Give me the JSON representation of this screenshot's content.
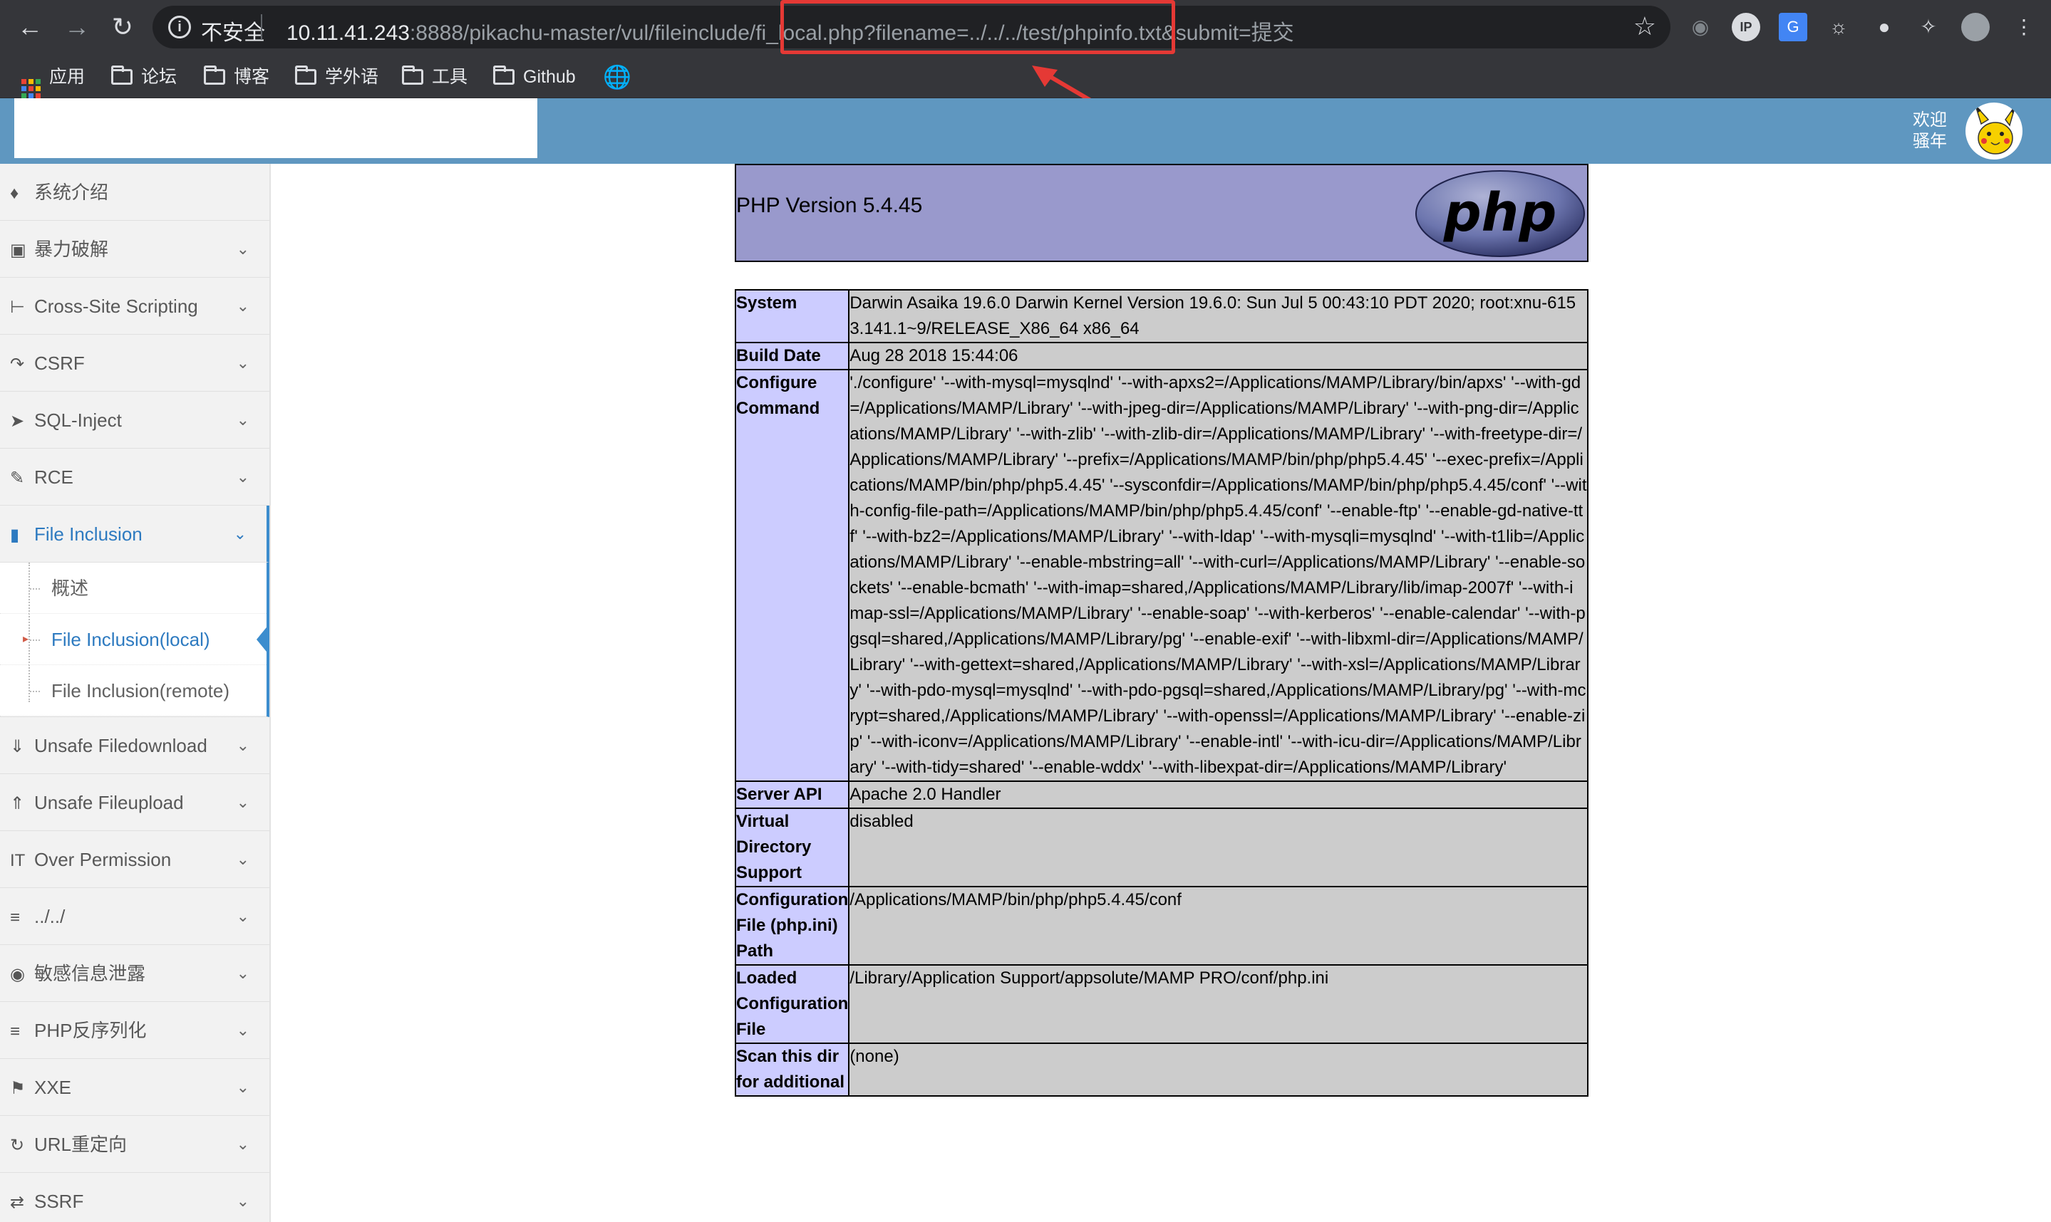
{
  "browser": {
    "insecure_label": "不安全",
    "url_host": "10.11.41.243",
    "url_rest": ":8888/pikachu-master/vul/fileinclude/fi_local.php?filename=../../../test/phpinfo.txt&submit=提交",
    "bookmarks": [
      "应用",
      "论坛",
      "博客",
      "学外语",
      "工具",
      "Github"
    ]
  },
  "header": {
    "welcome": "欢迎\n骚年"
  },
  "sidebar": {
    "items": [
      {
        "icon": "tag-icon",
        "label": "系统介绍",
        "chevron": false
      },
      {
        "icon": "lock-icon",
        "label": "暴力破解",
        "chevron": true
      },
      {
        "icon": "indent-icon",
        "label": "Cross-Site Scripting",
        "chevron": true
      },
      {
        "icon": "share-icon",
        "label": "CSRF",
        "chevron": true
      },
      {
        "icon": "fighter-jet-icon",
        "label": "SQL-Inject",
        "chevron": true
      },
      {
        "icon": "pencil-icon",
        "label": "RCE",
        "chevron": true
      },
      {
        "icon": "file-icon",
        "label": "File Inclusion",
        "chevron": true
      },
      {
        "icon": "download-icon",
        "label": "Unsafe Filedownload",
        "chevron": true
      },
      {
        "icon": "upload-icon",
        "label": "Unsafe Fileupload",
        "chevron": true
      },
      {
        "icon": "text-height-icon",
        "label": "Over Permission",
        "chevron": true
      },
      {
        "icon": "align-left-icon",
        "label": "../../",
        "chevron": true
      },
      {
        "icon": "camera-icon",
        "label": "敏感信息泄露",
        "chevron": true
      },
      {
        "icon": "list-icon",
        "label": "PHP反序列化",
        "chevron": true
      },
      {
        "icon": "flag-icon",
        "label": "XXE",
        "chevron": true
      },
      {
        "icon": "refresh-icon",
        "label": "URL重定向",
        "chevron": true
      },
      {
        "icon": "exchange-icon",
        "label": "SSRF",
        "chevron": true
      }
    ],
    "submenu": [
      "概述",
      "File Inclusion(local)",
      "File Inclusion(remote)"
    ]
  },
  "phpinfo": {
    "version": "PHP Version 5.4.45",
    "logo_text": "php",
    "rows": [
      {
        "key": "System",
        "value": "Darwin Asaika 19.6.0 Darwin Kernel Version 19.6.0: Sun Jul 5 00:43:10 PDT 2020; root:xnu-6153.141.1~9/RELEASE_X86_64 x86_64"
      },
      {
        "key": "Build Date",
        "value": "Aug 28 2018 15:44:06"
      },
      {
        "key": "Configure Command",
        "value": "'./configure' '--with-mysql=mysqlnd' '--with-apxs2=/Applications/MAMP/Library/bin/apxs' '--with-gd=/Applications/MAMP/Library' '--with-jpeg-dir=/Applications/MAMP/Library' '--with-png-dir=/Applications/MAMP/Library' '--with-zlib' '--with-zlib-dir=/Applications/MAMP/Library' '--with-freetype-dir=/Applications/MAMP/Library' '--prefix=/Applications/MAMP/bin/php/php5.4.45' '--exec-prefix=/Applications/MAMP/bin/php/php5.4.45' '--sysconfdir=/Applications/MAMP/bin/php/php5.4.45/conf' '--with-config-file-path=/Applications/MAMP/bin/php/php5.4.45/conf' '--enable-ftp' '--enable-gd-native-ttf' '--with-bz2=/Applications/MAMP/Library' '--with-ldap' '--with-mysqli=mysqlnd' '--with-t1lib=/Applications/MAMP/Library' '--enable-mbstring=all' '--with-curl=/Applications/MAMP/Library' '--enable-sockets' '--enable-bcmath' '--with-imap=shared,/Applications/MAMP/Library/lib/imap-2007f' '--with-imap-ssl=/Applications/MAMP/Library' '--enable-soap' '--with-kerberos' '--enable-calendar' '--with-pgsql=shared,/Applications/MAMP/Library/pg' '--enable-exif' '--with-libxml-dir=/Applications/MAMP/Library' '--with-gettext=shared,/Applications/MAMP/Library' '--with-xsl=/Applications/MAMP/Library' '--with-pdo-mysql=mysqlnd' '--with-pdo-pgsql=shared,/Applications/MAMP/Library/pg' '--with-mcrypt=shared,/Applications/MAMP/Library' '--with-openssl=/Applications/MAMP/Library' '--enable-zip' '--with-iconv=/Applications/MAMP/Library' '--enable-intl' '--with-icu-dir=/Applications/MAMP/Library' '--with-tidy=shared' '--enable-wddx' '--with-libexpat-dir=/Applications/MAMP/Library'"
      },
      {
        "key": "Server API",
        "value": "Apache 2.0 Handler"
      },
      {
        "key": "Virtual Directory Support",
        "value": "disabled"
      },
      {
        "key": "Configuration File (php.ini) Path",
        "value": "/Applications/MAMP/bin/php/php5.4.45/conf"
      },
      {
        "key": "Loaded Configuration File",
        "value": "/Library/Application Support/appsolute/MAMP PRO/conf/php.ini"
      },
      {
        "key": "Scan this dir for additional",
        "value": "(none)"
      }
    ]
  }
}
